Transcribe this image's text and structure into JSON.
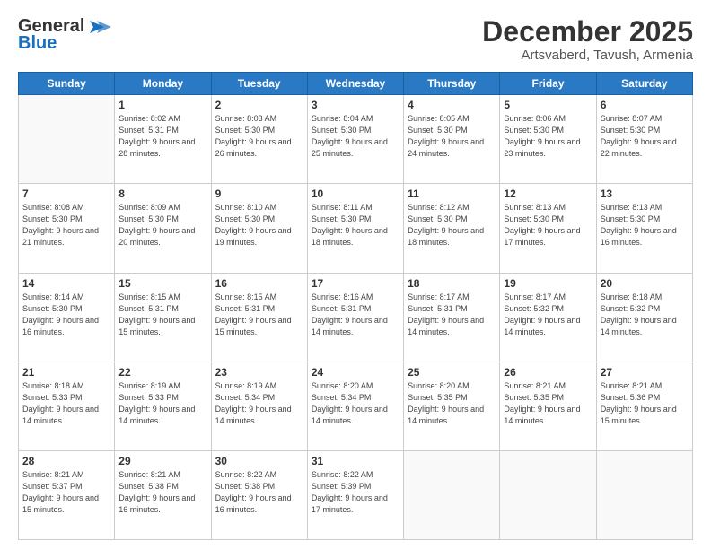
{
  "header": {
    "logo_general": "General",
    "logo_blue": "Blue",
    "month_title": "December 2025",
    "location": "Artsvaberd, Tavush, Armenia"
  },
  "days_of_week": [
    "Sunday",
    "Monday",
    "Tuesday",
    "Wednesday",
    "Thursday",
    "Friday",
    "Saturday"
  ],
  "weeks": [
    [
      {
        "day": "",
        "sunrise": "",
        "sunset": "",
        "daylight": ""
      },
      {
        "day": "1",
        "sunrise": "Sunrise: 8:02 AM",
        "sunset": "Sunset: 5:31 PM",
        "daylight": "Daylight: 9 hours and 28 minutes."
      },
      {
        "day": "2",
        "sunrise": "Sunrise: 8:03 AM",
        "sunset": "Sunset: 5:30 PM",
        "daylight": "Daylight: 9 hours and 26 minutes."
      },
      {
        "day": "3",
        "sunrise": "Sunrise: 8:04 AM",
        "sunset": "Sunset: 5:30 PM",
        "daylight": "Daylight: 9 hours and 25 minutes."
      },
      {
        "day": "4",
        "sunrise": "Sunrise: 8:05 AM",
        "sunset": "Sunset: 5:30 PM",
        "daylight": "Daylight: 9 hours and 24 minutes."
      },
      {
        "day": "5",
        "sunrise": "Sunrise: 8:06 AM",
        "sunset": "Sunset: 5:30 PM",
        "daylight": "Daylight: 9 hours and 23 minutes."
      },
      {
        "day": "6",
        "sunrise": "Sunrise: 8:07 AM",
        "sunset": "Sunset: 5:30 PM",
        "daylight": "Daylight: 9 hours and 22 minutes."
      }
    ],
    [
      {
        "day": "7",
        "sunrise": "Sunrise: 8:08 AM",
        "sunset": "Sunset: 5:30 PM",
        "daylight": "Daylight: 9 hours and 21 minutes."
      },
      {
        "day": "8",
        "sunrise": "Sunrise: 8:09 AM",
        "sunset": "Sunset: 5:30 PM",
        "daylight": "Daylight: 9 hours and 20 minutes."
      },
      {
        "day": "9",
        "sunrise": "Sunrise: 8:10 AM",
        "sunset": "Sunset: 5:30 PM",
        "daylight": "Daylight: 9 hours and 19 minutes."
      },
      {
        "day": "10",
        "sunrise": "Sunrise: 8:11 AM",
        "sunset": "Sunset: 5:30 PM",
        "daylight": "Daylight: 9 hours and 18 minutes."
      },
      {
        "day": "11",
        "sunrise": "Sunrise: 8:12 AM",
        "sunset": "Sunset: 5:30 PM",
        "daylight": "Daylight: 9 hours and 18 minutes."
      },
      {
        "day": "12",
        "sunrise": "Sunrise: 8:13 AM",
        "sunset": "Sunset: 5:30 PM",
        "daylight": "Daylight: 9 hours and 17 minutes."
      },
      {
        "day": "13",
        "sunrise": "Sunrise: 8:13 AM",
        "sunset": "Sunset: 5:30 PM",
        "daylight": "Daylight: 9 hours and 16 minutes."
      }
    ],
    [
      {
        "day": "14",
        "sunrise": "Sunrise: 8:14 AM",
        "sunset": "Sunset: 5:30 PM",
        "daylight": "Daylight: 9 hours and 16 minutes."
      },
      {
        "day": "15",
        "sunrise": "Sunrise: 8:15 AM",
        "sunset": "Sunset: 5:31 PM",
        "daylight": "Daylight: 9 hours and 15 minutes."
      },
      {
        "day": "16",
        "sunrise": "Sunrise: 8:15 AM",
        "sunset": "Sunset: 5:31 PM",
        "daylight": "Daylight: 9 hours and 15 minutes."
      },
      {
        "day": "17",
        "sunrise": "Sunrise: 8:16 AM",
        "sunset": "Sunset: 5:31 PM",
        "daylight": "Daylight: 9 hours and 14 minutes."
      },
      {
        "day": "18",
        "sunrise": "Sunrise: 8:17 AM",
        "sunset": "Sunset: 5:31 PM",
        "daylight": "Daylight: 9 hours and 14 minutes."
      },
      {
        "day": "19",
        "sunrise": "Sunrise: 8:17 AM",
        "sunset": "Sunset: 5:32 PM",
        "daylight": "Daylight: 9 hours and 14 minutes."
      },
      {
        "day": "20",
        "sunrise": "Sunrise: 8:18 AM",
        "sunset": "Sunset: 5:32 PM",
        "daylight": "Daylight: 9 hours and 14 minutes."
      }
    ],
    [
      {
        "day": "21",
        "sunrise": "Sunrise: 8:18 AM",
        "sunset": "Sunset: 5:33 PM",
        "daylight": "Daylight: 9 hours and 14 minutes."
      },
      {
        "day": "22",
        "sunrise": "Sunrise: 8:19 AM",
        "sunset": "Sunset: 5:33 PM",
        "daylight": "Daylight: 9 hours and 14 minutes."
      },
      {
        "day": "23",
        "sunrise": "Sunrise: 8:19 AM",
        "sunset": "Sunset: 5:34 PM",
        "daylight": "Daylight: 9 hours and 14 minutes."
      },
      {
        "day": "24",
        "sunrise": "Sunrise: 8:20 AM",
        "sunset": "Sunset: 5:34 PM",
        "daylight": "Daylight: 9 hours and 14 minutes."
      },
      {
        "day": "25",
        "sunrise": "Sunrise: 8:20 AM",
        "sunset": "Sunset: 5:35 PM",
        "daylight": "Daylight: 9 hours and 14 minutes."
      },
      {
        "day": "26",
        "sunrise": "Sunrise: 8:21 AM",
        "sunset": "Sunset: 5:35 PM",
        "daylight": "Daylight: 9 hours and 14 minutes."
      },
      {
        "day": "27",
        "sunrise": "Sunrise: 8:21 AM",
        "sunset": "Sunset: 5:36 PM",
        "daylight": "Daylight: 9 hours and 15 minutes."
      }
    ],
    [
      {
        "day": "28",
        "sunrise": "Sunrise: 8:21 AM",
        "sunset": "Sunset: 5:37 PM",
        "daylight": "Daylight: 9 hours and 15 minutes."
      },
      {
        "day": "29",
        "sunrise": "Sunrise: 8:21 AM",
        "sunset": "Sunset: 5:38 PM",
        "daylight": "Daylight: 9 hours and 16 minutes."
      },
      {
        "day": "30",
        "sunrise": "Sunrise: 8:22 AM",
        "sunset": "Sunset: 5:38 PM",
        "daylight": "Daylight: 9 hours and 16 minutes."
      },
      {
        "day": "31",
        "sunrise": "Sunrise: 8:22 AM",
        "sunset": "Sunset: 5:39 PM",
        "daylight": "Daylight: 9 hours and 17 minutes."
      },
      {
        "day": "",
        "sunrise": "",
        "sunset": "",
        "daylight": ""
      },
      {
        "day": "",
        "sunrise": "",
        "sunset": "",
        "daylight": ""
      },
      {
        "day": "",
        "sunrise": "",
        "sunset": "",
        "daylight": ""
      }
    ]
  ]
}
